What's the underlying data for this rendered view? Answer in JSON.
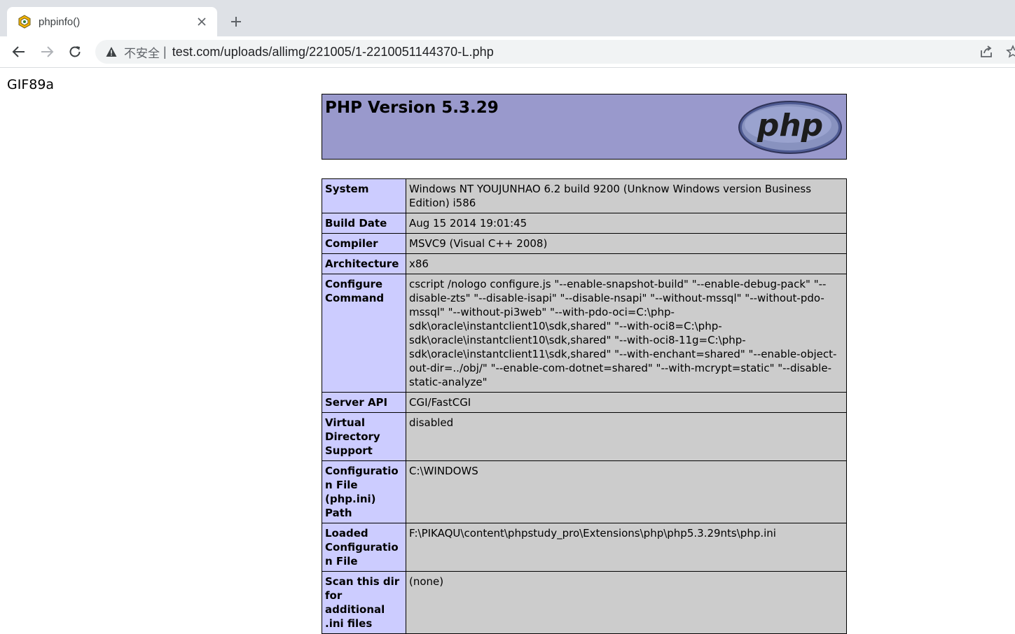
{
  "browser": {
    "tab_title": "phpinfo()",
    "insecure_label": "不安全",
    "separator": "|",
    "url": "test.com/uploads/allimg/221005/1-2210051144370-L.php"
  },
  "page": {
    "gif_header": "GIF89a",
    "php_version": "PHP Version 5.3.29",
    "logo_text": "php",
    "rows": [
      {
        "key": "System",
        "value": "Windows NT YOUJUNHAO 6.2 build 9200 (Unknow Windows version Business Edition) i586"
      },
      {
        "key": "Build Date",
        "value": "Aug 15 2014 19:01:45"
      },
      {
        "key": "Compiler",
        "value": "MSVC9 (Visual C++ 2008)"
      },
      {
        "key": "Architecture",
        "value": "x86"
      },
      {
        "key": "Configure Command",
        "value": "cscript /nologo configure.js \"--enable-snapshot-build\" \"--enable-debug-pack\" \"--disable-zts\" \"--disable-isapi\" \"--disable-nsapi\" \"--without-mssql\" \"--without-pdo-mssql\" \"--without-pi3web\" \"--with-pdo-oci=C:\\php-sdk\\oracle\\instantclient10\\sdk,shared\" \"--with-oci8=C:\\php-sdk\\oracle\\instantclient10\\sdk,shared\" \"--with-oci8-11g=C:\\php-sdk\\oracle\\instantclient11\\sdk,shared\" \"--with-enchant=shared\" \"--enable-object-out-dir=../obj/\" \"--enable-com-dotnet=shared\" \"--with-mcrypt=static\" \"--disable-static-analyze\""
      },
      {
        "key": "Server API",
        "value": "CGI/FastCGI"
      },
      {
        "key": "Virtual Directory Support",
        "value": "disabled"
      },
      {
        "key": "Configuration File (php.ini) Path",
        "value": "C:\\WINDOWS"
      },
      {
        "key": "Loaded Configuration File",
        "value": "F:\\PIKAQU\\content\\phpstudy_pro\\Extensions\\php\\php5.3.29nts\\php.ini"
      },
      {
        "key": "Scan this dir for additional .ini files",
        "value": "(none)"
      }
    ]
  }
}
